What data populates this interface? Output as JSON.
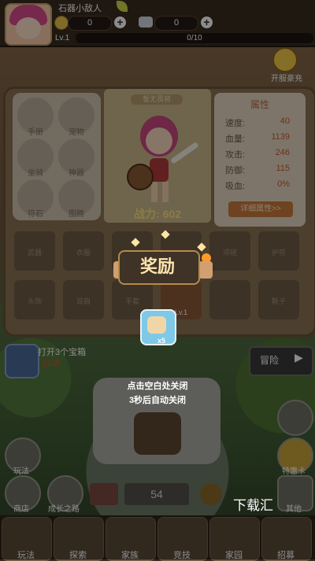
{
  "player": {
    "name": "石器小敌人",
    "level": "Lv.1",
    "xp": "0/10"
  },
  "resources": [
    {
      "icon": "coin-icon",
      "value": "0"
    },
    {
      "icon": "gem-icon",
      "value": "0"
    }
  ],
  "open_server": {
    "label": "开服豪充"
  },
  "hero": {
    "title": "誓无畏将",
    "power": "战力: 602"
  },
  "side_menu": [
    "手册",
    "宠物",
    "坐骑",
    "神器",
    "符石",
    "图腾"
  ],
  "attributes": {
    "title": "属性",
    "rows": [
      {
        "key": "速度:",
        "value": "40"
      },
      {
        "key": "血量:",
        "value": "1139"
      },
      {
        "key": "攻击:",
        "value": "246"
      },
      {
        "key": "防御:",
        "value": "115"
      },
      {
        "key": "吸血:",
        "value": "0%"
      }
    ],
    "detail_button": "详细属性>>"
  },
  "equip_grid": [
    "武器",
    "衣服",
    "",
    "",
    "项链",
    "护符",
    "头饰",
    "双肩",
    "手套",
    "Lv.1",
    "",
    "靴子"
  ],
  "reward": {
    "title": "奖励",
    "item_count": "x5",
    "tip_line1": "点击空白处关闭",
    "tip_line2": "3秒后自动关闭"
  },
  "quest": {
    "text": "打开3个宝箱",
    "progress": "(0/3)"
  },
  "adventure": {
    "label": "冒险"
  },
  "left_buttons": [
    "玩法",
    "商店",
    "成长之路"
  ],
  "right_buttons": [
    "特惠卡",
    "其他"
  ],
  "counter": "54",
  "watermark": "下载汇",
  "bottom_nav": [
    "玩法",
    "探索",
    "家族",
    "竞技",
    "家园",
    "招募"
  ]
}
